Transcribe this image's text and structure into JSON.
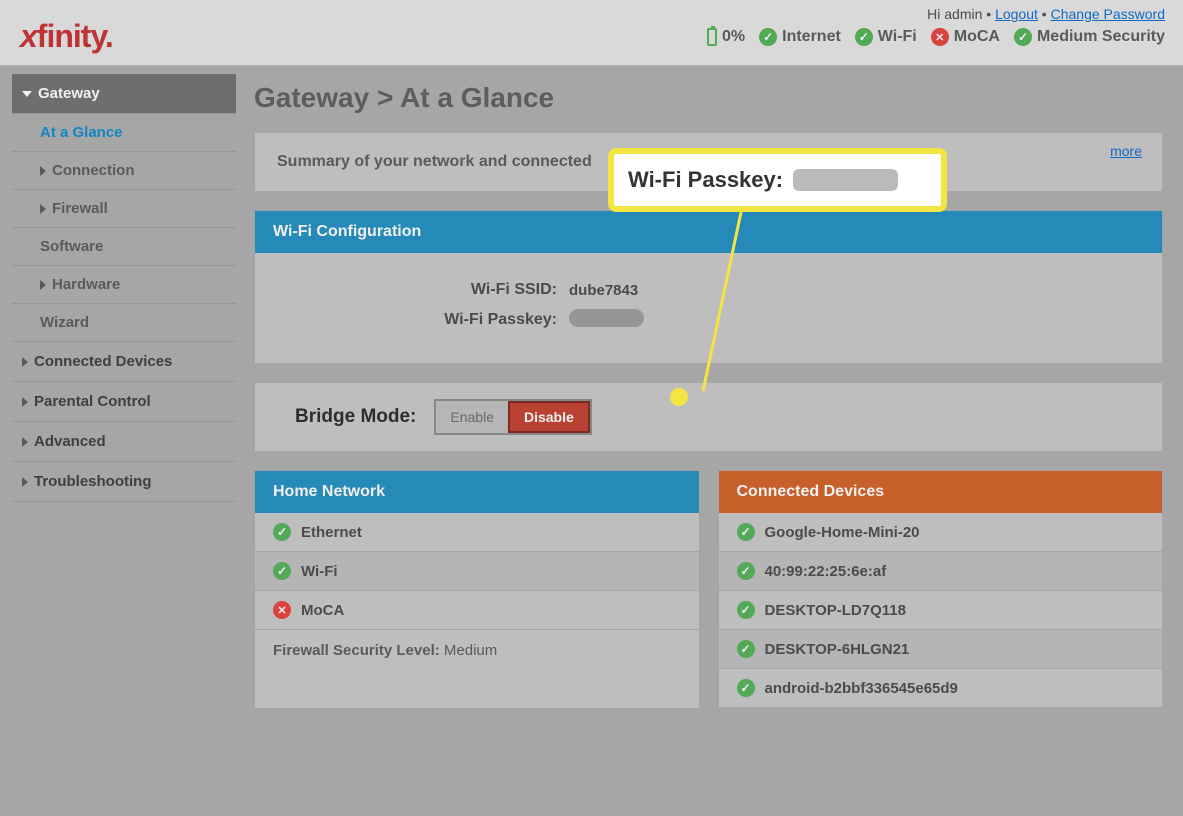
{
  "header": {
    "logo": "xfinity.",
    "greeting_prefix": "Hi ",
    "user": "admin",
    "logout": "Logout",
    "change_password": "Change Password",
    "status": {
      "battery": "0%",
      "internet": "Internet",
      "wifi": "Wi-Fi",
      "moca": "MoCA",
      "security": "Medium Security"
    }
  },
  "sidebar": {
    "gateway": "Gateway",
    "at_a_glance": "At a Glance",
    "connection": "Connection",
    "firewall": "Firewall",
    "software": "Software",
    "hardware": "Hardware",
    "wizard": "Wizard",
    "connected_devices": "Connected Devices",
    "parental_control": "Parental Control",
    "advanced": "Advanced",
    "troubleshooting": "Troubleshooting"
  },
  "main": {
    "title": "Gateway > At a Glance",
    "summary_text": "Summary of your network and connected ",
    "more": "more",
    "wifi_config_header": "Wi-Fi Configuration",
    "ssid_label": "Wi-Fi SSID:",
    "ssid_value": "dube7843",
    "passkey_label": "Wi-Fi Passkey:",
    "bridge_label": "Bridge Mode:",
    "enable": "Enable",
    "disable": "Disable",
    "home_network": {
      "header": "Home Network",
      "ethernet": "Ethernet",
      "wifi": "Wi-Fi",
      "moca": "MoCA",
      "firewall_label": "Firewall Security Level: ",
      "firewall_value": "Medium"
    },
    "connected_devices": {
      "header": "Connected Devices",
      "items": [
        "Google-Home-Mini-20",
        "40:99:22:25:6e:af",
        "DESKTOP-LD7Q118",
        "DESKTOP-6HLGN21",
        "android-b2bbf336545e65d9"
      ]
    }
  },
  "callout": {
    "label": "Wi-Fi Passkey:"
  }
}
